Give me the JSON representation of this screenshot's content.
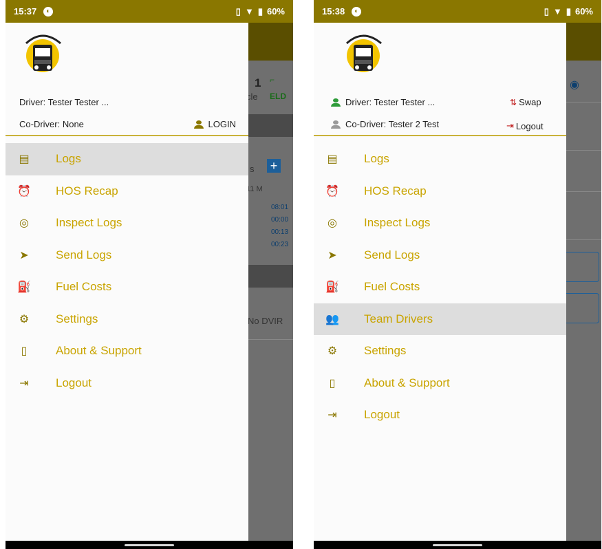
{
  "left": {
    "status": {
      "time": "15:37",
      "battery": "60%"
    },
    "driver": "Driver: Tester Tester ...",
    "codriver": "Co-Driver: None",
    "login_label": "LOGIN",
    "background": {
      "vehicle_num": "1",
      "vehicle_word": "cle",
      "eld": "ELD",
      "logs_s": "s",
      "hours_label": "11 M",
      "times": [
        "08:01",
        "00:00",
        "00:13",
        "00:23"
      ],
      "dvir": "No DVIR"
    },
    "menu": [
      {
        "label": "Logs",
        "icon": "logs-icon"
      },
      {
        "label": "HOS Recap",
        "icon": "alarm-clock-icon"
      },
      {
        "label": "Inspect Logs",
        "icon": "inspect-icon"
      },
      {
        "label": "Send Logs",
        "icon": "send-icon"
      },
      {
        "label": "Fuel Costs",
        "icon": "fuel-icon"
      },
      {
        "label": "Settings",
        "icon": "gear-icon"
      },
      {
        "label": "About & Support",
        "icon": "phone-icon"
      },
      {
        "label": "Logout",
        "icon": "logout-icon"
      }
    ]
  },
  "right": {
    "status": {
      "time": "15:38",
      "battery": "60%"
    },
    "driver": "Driver: Tester Tester ...",
    "codriver": "Co-Driver: Tester 2 Test",
    "swap_label": "Swap",
    "logout_label": "Logout",
    "menu": [
      {
        "label": "Logs",
        "icon": "logs-icon"
      },
      {
        "label": "HOS Recap",
        "icon": "alarm-clock-icon"
      },
      {
        "label": "Inspect Logs",
        "icon": "inspect-icon"
      },
      {
        "label": "Send Logs",
        "icon": "send-icon"
      },
      {
        "label": "Fuel Costs",
        "icon": "fuel-icon"
      },
      {
        "label": "Team Drivers",
        "icon": "team-icon"
      },
      {
        "label": "Settings",
        "icon": "gear-icon"
      },
      {
        "label": "About & Support",
        "icon": "phone-icon"
      },
      {
        "label": "Logout",
        "icon": "logout-icon"
      }
    ]
  },
  "colors": {
    "accent": "#8a7700",
    "menu_text": "#c9a400",
    "active_bg": "#dddddd"
  }
}
